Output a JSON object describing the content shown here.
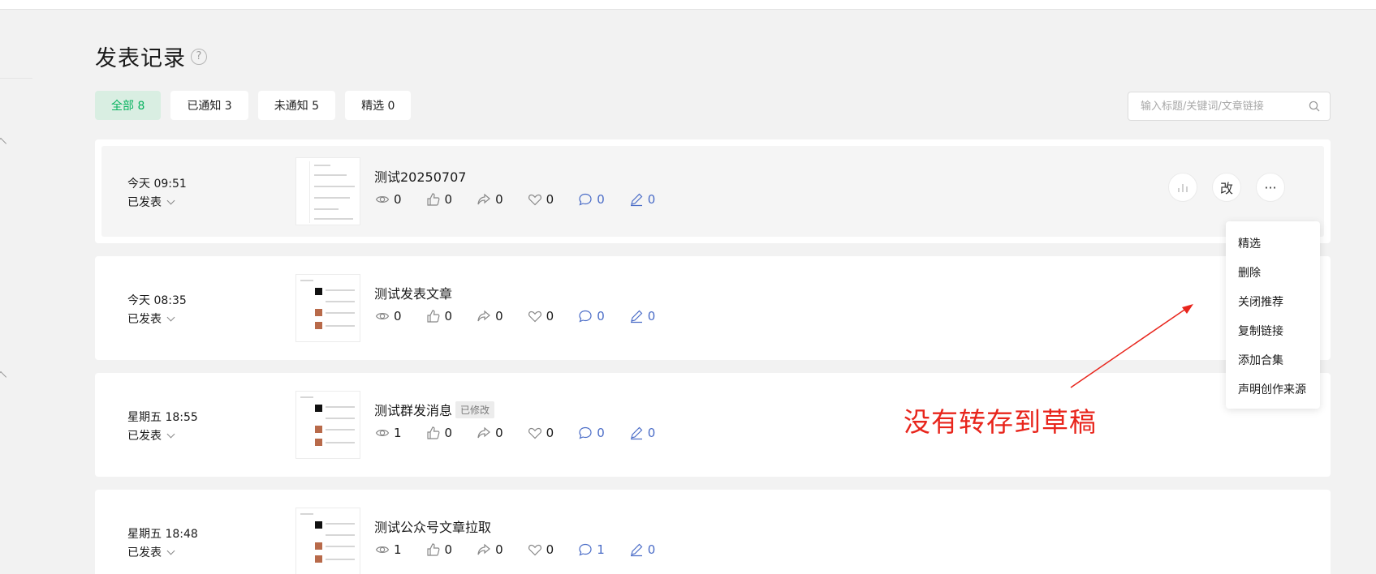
{
  "page": {
    "title": "发表记录",
    "help_icon": "?"
  },
  "filters": [
    {
      "label": "全部 8",
      "active": true
    },
    {
      "label": "已通知 3",
      "active": false
    },
    {
      "label": "未通知 5",
      "active": false
    },
    {
      "label": "精选 0",
      "active": false
    }
  ],
  "search": {
    "placeholder": "输入标题/关键词/文章链接",
    "icon": "search-icon"
  },
  "articles": [
    {
      "time": "今天 09:51",
      "status": "已发表",
      "title": "测试20250707",
      "tag": "",
      "stats": {
        "views": "0",
        "likes": "0",
        "shares": "0",
        "favorites": "0",
        "comments": "0",
        "edits": "0"
      },
      "actions": {
        "edit_label": "改",
        "more_label": "···"
      }
    },
    {
      "time": "今天 08:35",
      "status": "已发表",
      "title": "测试发表文章",
      "tag": "",
      "stats": {
        "views": "0",
        "likes": "0",
        "shares": "0",
        "favorites": "0",
        "comments": "0",
        "edits": "0"
      }
    },
    {
      "time": "星期五 18:55",
      "status": "已发表",
      "title": "测试群发消息",
      "tag": "已修改",
      "stats": {
        "views": "1",
        "likes": "0",
        "shares": "0",
        "favorites": "0",
        "comments": "0",
        "edits": "0"
      }
    },
    {
      "time": "星期五 18:48",
      "status": "已发表",
      "title": "测试公众号文章拉取",
      "tag": "",
      "stats": {
        "views": "1",
        "likes": "0",
        "shares": "0",
        "favorites": "0",
        "comments": "1",
        "edits": "0"
      }
    }
  ],
  "more_menu": [
    "精选",
    "删除",
    "关闭推荐",
    "复制链接",
    "添加合集",
    "声明创作来源"
  ],
  "annotation": {
    "text": "没有转存到草稿",
    "color": "#e8251c"
  },
  "colors": {
    "accent": "#07b35f",
    "accent_bg": "#d9eee2",
    "comment_blue": "#4a6cc7"
  }
}
